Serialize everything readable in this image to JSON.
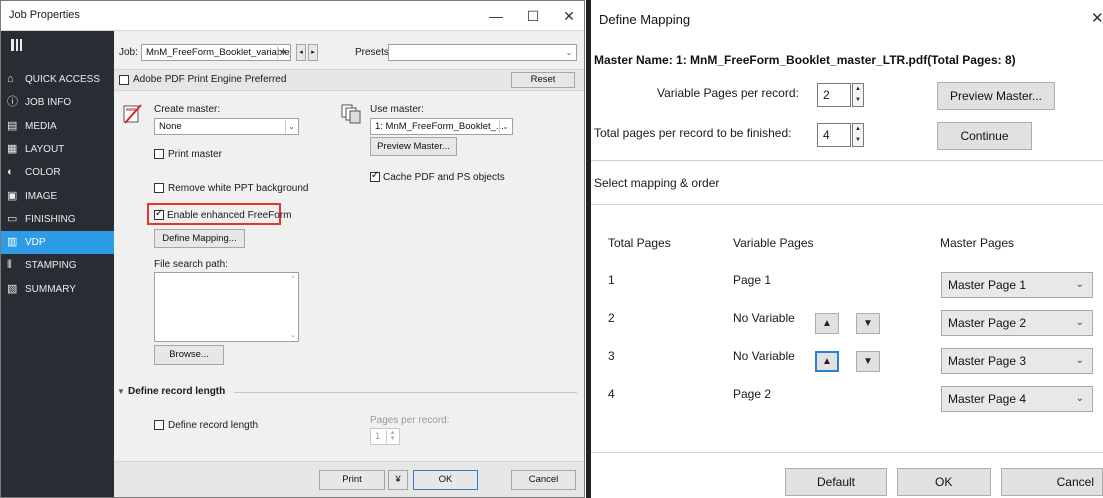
{
  "job_properties": {
    "title": "Job Properties",
    "win_minimize": "—",
    "win_maximize": "☐",
    "win_close": "✕",
    "sidebar": [
      {
        "label": "QUICK ACCESS",
        "icon": "home-icon"
      },
      {
        "label": "JOB INFO",
        "icon": "info-icon"
      },
      {
        "label": "MEDIA",
        "icon": "media-icon"
      },
      {
        "label": "LAYOUT",
        "icon": "layout-icon"
      },
      {
        "label": "COLOR",
        "icon": "color-icon"
      },
      {
        "label": "IMAGE",
        "icon": "image-icon"
      },
      {
        "label": "FINISHING",
        "icon": "finishing-icon"
      },
      {
        "label": "VDP",
        "icon": "vdp-icon",
        "active": true
      },
      {
        "label": "STAMPING",
        "icon": "stamping-icon"
      },
      {
        "label": "SUMMARY",
        "icon": "summary-icon"
      }
    ],
    "job_label": "Job:",
    "job_value": "MnM_FreeForm_Booklet_variable_L",
    "presets_label": "Presets:",
    "presets_value": "",
    "adobe_engine_label": "Adobe PDF Print Engine Preferred",
    "adobe_engine_checked": false,
    "reset_label": "Reset",
    "create_master_label": "Create master:",
    "create_master_value": "None",
    "use_master_label": "Use master:",
    "use_master_value": "1: MnM_FreeForm_Booklet_...",
    "preview_master_label": "Preview Master...",
    "print_master_label": "Print master",
    "print_master_checked": false,
    "cache_pdf_label": "Cache PDF and PS objects",
    "cache_pdf_checked": true,
    "remove_white_label": "Remove white PPT background",
    "remove_white_checked": false,
    "enable_freeform_label": "Enable enhanced FreeForm",
    "enable_freeform_checked": true,
    "define_mapping_label": "Define Mapping...",
    "file_search_label": "File search path:",
    "browse_label": "Browse...",
    "define_record_section": "Define record length",
    "define_record_label": "Define record length",
    "define_record_checked": false,
    "pages_per_record_label": "Pages per record:",
    "pages_per_record_value": "1",
    "print_label": "Print",
    "print_menu_glyph": "¥",
    "ok_label": "OK",
    "cancel_label": "Cancel",
    "highlight_color": "#e8352a",
    "accent_color": "#2e9be6"
  },
  "define_mapping": {
    "title": "Define Mapping",
    "close_glyph": "✕",
    "master_name": "Master Name: 1: MnM_FreeForm_Booklet_master_LTR.pdf(Total Pages: 8)",
    "var_pages_label": "Variable Pages per record:",
    "var_pages_value": "2",
    "total_pages_label": "Total pages per record to be finished:",
    "total_pages_value": "4",
    "preview_master_label": "Preview Master...",
    "continue_label": "Continue",
    "select_mapping_label": "Select mapping & order",
    "headers": {
      "total": "Total Pages",
      "variable": "Variable Pages",
      "master": "Master Pages"
    },
    "rows": [
      {
        "total": "1",
        "variable": "Page 1",
        "master": "Master Page 1",
        "arrows": false
      },
      {
        "total": "2",
        "variable": "No Variable",
        "master": "Master Page 2",
        "arrows": true
      },
      {
        "total": "3",
        "variable": "No Variable",
        "master": "Master Page 3",
        "arrows": true
      },
      {
        "total": "4",
        "variable": "Page 2",
        "master": "Master Page 4",
        "arrows": false
      }
    ],
    "default_label": "Default",
    "ok_label": "OK",
    "cancel_label": "Cancel"
  }
}
